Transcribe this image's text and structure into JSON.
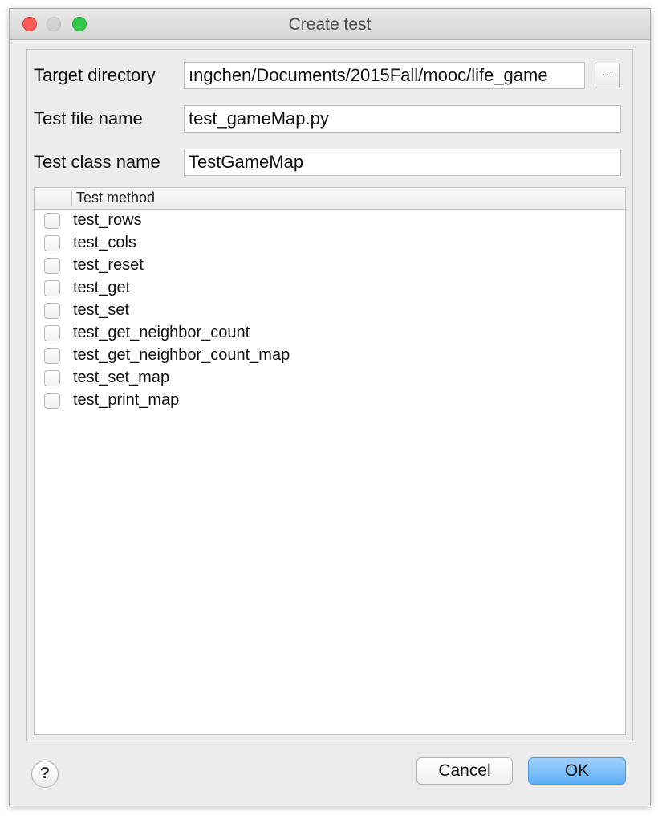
{
  "window": {
    "title": "Create test"
  },
  "form": {
    "target_directory_label": "Target directory",
    "target_directory_value": "ıngchen/Documents/2015Fall/mooc/life_game",
    "browse_label": "···",
    "test_file_name_label": "Test file name",
    "test_file_name_value": "test_gameMap.py",
    "test_class_name_label": "Test class name",
    "test_class_name_value": "TestGameMap"
  },
  "table": {
    "header": "Test method",
    "rows": [
      {
        "label": "test_rows",
        "checked": false
      },
      {
        "label": "test_cols",
        "checked": false
      },
      {
        "label": "test_reset",
        "checked": false
      },
      {
        "label": "test_get",
        "checked": false
      },
      {
        "label": "test_set",
        "checked": false
      },
      {
        "label": "test_get_neighbor_count",
        "checked": false
      },
      {
        "label": "test_get_neighbor_count_map",
        "checked": false
      },
      {
        "label": "test_set_map",
        "checked": false
      },
      {
        "label": "test_print_map",
        "checked": false
      }
    ]
  },
  "footer": {
    "help_label": "?",
    "cancel_label": "Cancel",
    "ok_label": "OK"
  },
  "colors": {
    "ok_button": "#6db8f8",
    "close_light": "#fc5b57",
    "maximize_light": "#34c84a"
  }
}
